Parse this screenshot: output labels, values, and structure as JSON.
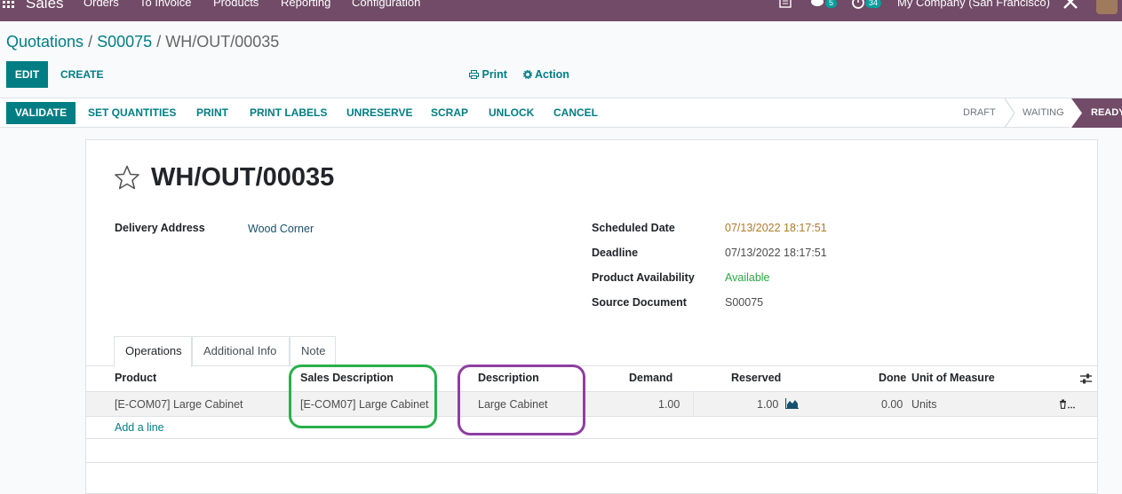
{
  "topbar": {
    "app_name": "Sales",
    "menus": [
      "Orders",
      "To Invoice",
      "Products",
      "Reporting",
      "Configuration"
    ],
    "messages_count": "5",
    "activities_count": "34",
    "company": "My Company (San Francisco)"
  },
  "breadcrumb": {
    "level1": "Quotations",
    "sep": "/",
    "level2": "S00075",
    "current": "WH/OUT/00035"
  },
  "control": {
    "edit_label": "EDIT",
    "create_label": "CREATE",
    "print_label": "Print",
    "action_label": "Action"
  },
  "statusbar": {
    "buttons": [
      "VALIDATE",
      "SET QUANTITIES",
      "PRINT",
      "PRINT LABELS",
      "UNRESERVE",
      "SCRAP",
      "UNLOCK",
      "CANCEL"
    ],
    "states": [
      "DRAFT",
      "WAITING",
      "READY"
    ],
    "active_state": "READY"
  },
  "record": {
    "title": "WH/OUT/00035",
    "delivery_address_label": "Delivery Address",
    "delivery_address": "Wood Corner",
    "scheduled_date_label": "Scheduled Date",
    "scheduled_date": "07/13/2022 18:17:51",
    "deadline_label": "Deadline",
    "deadline": "07/13/2022 18:17:51",
    "availability_label": "Product Availability",
    "availability": "Available",
    "source_label": "Source Document",
    "source": "S00075"
  },
  "tabs": [
    "Operations",
    "Additional Info",
    "Note"
  ],
  "table": {
    "headers": {
      "product": "Product",
      "sales_description": "Sales Description",
      "description": "Description",
      "demand": "Demand",
      "reserved": "Reserved",
      "done": "Done",
      "uom": "Unit of Measure"
    },
    "rows": [
      {
        "product": "[E-COM07] Large Cabinet",
        "sales_description": "[E-COM07] Large Cabinet",
        "description": "Large Cabinet",
        "demand": "1.00",
        "reserved": "1.00",
        "done": "0.00",
        "uom": "Units"
      }
    ],
    "add_line": "Add a line"
  },
  "colors": {
    "brand": "#714b67",
    "accent": "#017e84",
    "green_highlight": "#28b04a",
    "purple_highlight": "#8e3fa0",
    "scheduled_date": "#b07a2b",
    "available": "#28a745"
  }
}
